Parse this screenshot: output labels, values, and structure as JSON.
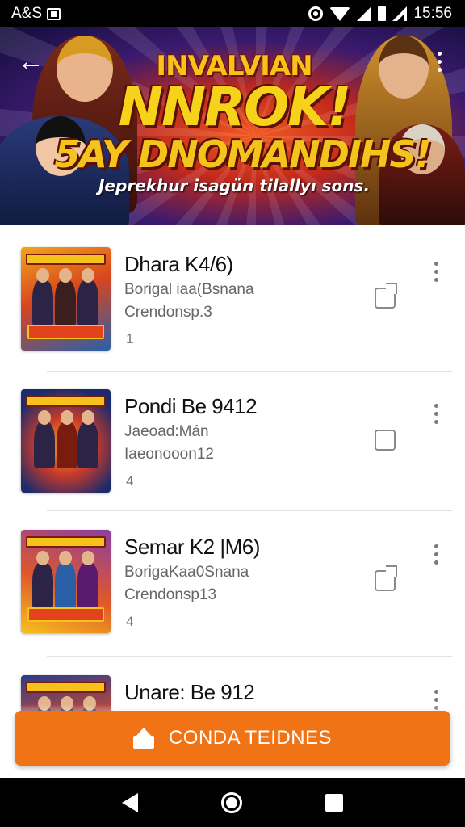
{
  "status_bar": {
    "left_text": "A&S",
    "time": "15:56"
  },
  "banner": {
    "line1": "INVALVIAN",
    "line2": "NNROK!",
    "line3": "5AY DNOMANDIHS!",
    "tagline": "Jeprekhur isagün tilallyı sons."
  },
  "list": {
    "items": [
      {
        "title": "Dhara K4/6)",
        "sub1": "Borigal iaa(Bsnana",
        "sub2": "Crendonsp.3",
        "count": "1",
        "action": "share",
        "thumb_colors": [
          "#f2a51a",
          "#d8451f",
          "#2a5fa8"
        ]
      },
      {
        "title": "Pondi Be 9412",
        "sub1": "Jaeoad:Mán",
        "sub2": "Iaeonooon12",
        "count": "4",
        "action": "checkbox",
        "thumb_colors": [
          "#1b2b6b",
          "#c83a2a",
          "#f0a821"
        ]
      },
      {
        "title": "Semar K2 |M6)",
        "sub1": "BorigaKaa0Snana",
        "sub2": "Crendonsp13",
        "count": "4",
        "action": "share",
        "thumb_colors": [
          "#8a3fa3",
          "#e0582a",
          "#f5c21b"
        ]
      },
      {
        "title": "Unare: Be 912",
        "sub1": "",
        "sub2": "",
        "count": "",
        "action": "none",
        "thumb_colors": [
          "#2a3c8a",
          "#d54a2a",
          "#f5c21b"
        ]
      }
    ]
  },
  "cta": {
    "label": "CONDA TEIDNES"
  },
  "colors": {
    "accent": "#f07416",
    "status_bar": "#000000"
  }
}
